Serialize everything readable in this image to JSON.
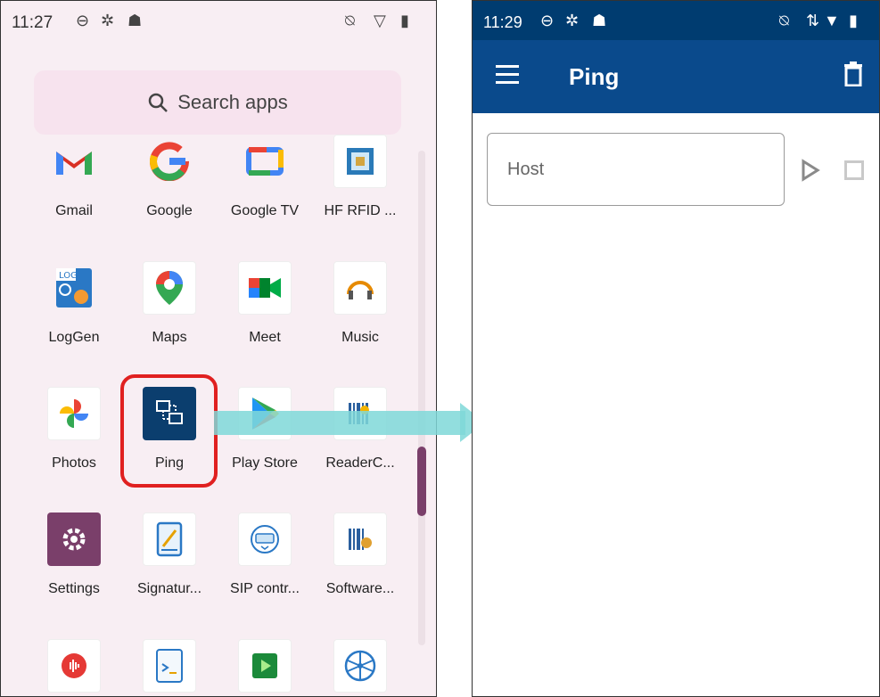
{
  "left_status": {
    "time": "11:27"
  },
  "search": {
    "placeholder": "Search apps"
  },
  "apps": [
    {
      "name": "Gmail"
    },
    {
      "name": "Google"
    },
    {
      "name": "Google TV"
    },
    {
      "name": "HF RFID ..."
    },
    {
      "name": "LogGen"
    },
    {
      "name": "Maps"
    },
    {
      "name": "Meet"
    },
    {
      "name": "Music"
    },
    {
      "name": "Photos"
    },
    {
      "name": "Ping"
    },
    {
      "name": "Play Store"
    },
    {
      "name": "ReaderC..."
    },
    {
      "name": "Settings"
    },
    {
      "name": "Signatur..."
    },
    {
      "name": "SIP contr..."
    },
    {
      "name": "Software..."
    }
  ],
  "right_status": {
    "time": "11:29"
  },
  "ping_app": {
    "title": "Ping",
    "host_placeholder": "Host"
  },
  "colors": {
    "launcher_bg": "#f8eef3",
    "app_bar": "#0a4a8c",
    "status_bar_right": "#003c70",
    "highlight": "#e02020",
    "arrow": "#7fd8d8"
  }
}
